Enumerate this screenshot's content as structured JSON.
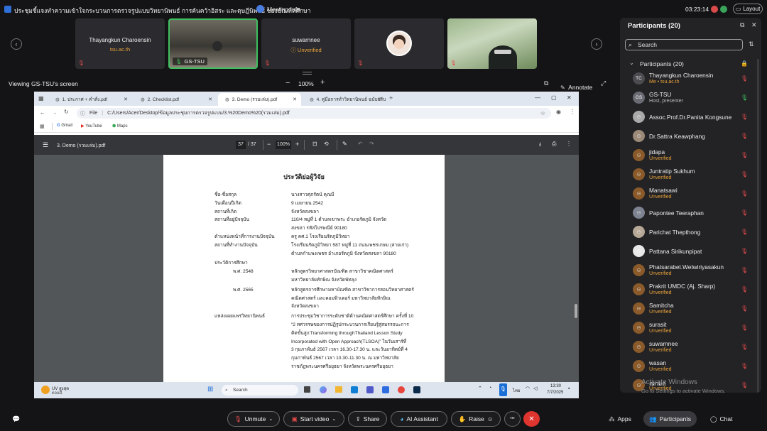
{
  "topbar": {
    "title": "ประชุมชี้แจงทำความเข้าใจกระบวนการตรวจรูปแบบวิทยานิพนธ์ การค้นคว้าอิสระ และดุษฎีนิพนธ์ ของบัณฑิตศึกษา",
    "meeting_info": "Meeting Info",
    "clock": "03:23:14",
    "layout": "Layout"
  },
  "filmstrip": [
    {
      "name": "Thayangkun Charoensin",
      "sub": "tsu.ac.th",
      "sub_color": "#e9a23b"
    },
    {
      "name": "GS-TSU",
      "sub": "",
      "sub_color": "#ffffff"
    },
    {
      "name": "suwarnnee",
      "sub": "Unverified",
      "sub_color": "#e9a23b"
    },
    {
      "name": "",
      "sub": "",
      "sub_color": "#ffffff"
    },
    {
      "name": "",
      "sub": "",
      "sub_color": "#ffffff"
    }
  ],
  "viewing": {
    "label": "Viewing GS-TSU's screen",
    "zoom": "100%",
    "annotate": "Annotate"
  },
  "browser": {
    "tabs": [
      "1. ประกาศ + คำสั่ง.pdf",
      "2. Checklist.pdf",
      "3. Demo (รวมเล่ม).pdf",
      "4. คู่มือการทำวิทยานิพนธ์ ฉบับปรับ"
    ],
    "url_prefix": "File",
    "url": "C:/Users/Acer/Desktop/ข้อมูลประชุมการตรวจรูปแบบ/3.%20Demo%20(รวมเล่ม).pdf",
    "bookmarks": [
      "Gmail",
      "YouTube",
      "Maps"
    ],
    "pdf_title": "3. Demo (รวมเล่ม).pdf",
    "page_current": "37",
    "page_total": "/ 37",
    "pdf_zoom": "100%"
  },
  "document": {
    "heading": "ประวัติย่อผู้วิจัย",
    "rows": [
      {
        "label": "ชื่อ-ชื่อสกุล",
        "value": "นางสาวศุภรัตน์ คุณมี"
      },
      {
        "label": "วันเดือนปีเกิด",
        "value": "9 เมษายน 2542"
      },
      {
        "label": "สถานที่เกิด",
        "value": "จังหวัดสงขลา"
      },
      {
        "label": "สถานที่อยู่ปัจจุบัน",
        "value": "110/4 หมู่ที่ 1 ตำบลเขาพระ อำเภอรัตภูมิ จังหวัด"
      },
      {
        "label": "",
        "value": "สงขลา รหัสไปรษณีย์ 90180"
      },
      {
        "label": "ตำแหน่งหน้าที่การงานปัจจุบัน",
        "value": "ครู คศ.1 โรงเรียนรัตภูมิวิทยา"
      },
      {
        "label": "สถานที่ทำงานปัจจุบัน",
        "value": "โรงเรียนรัตภูมิวิทยา 587 หมู่ที่ 11 ถนนเพชรเกษม (สายเก่า)"
      },
      {
        "label": "",
        "value": "ตำบลกำแพงเพชร อำเภอรัตภูมิ จังหวัดสงขลา 90180"
      }
    ],
    "edu_label": "ประวัติการศึกษา",
    "edu": [
      {
        "year": "พ.ศ. 2548",
        "lines": [
          "หลักสูตรวิทยาศาสตรบัณฑิต สาขาวิชาคณิตศาสตร์",
          "มหาวิทยาลัยทักษิณ จังหวัดพัทลุง"
        ]
      },
      {
        "year": "พ.ศ. 2565",
        "lines": [
          "หลักสูตรการศึกษามหาบัณฑิต สาขาวิชาการสอนวิทยาศาสตร์",
          "คณิตศาสตร์ และคอมพิวเตอร์ มหาวิทยาลัยทักษิณ",
          "จังหวัดสงขลา"
        ]
      }
    ],
    "pub_label": "แหล่งเผยแพร่วิทยานิพนธ์",
    "pub_lines": [
      "การประชุมวิชาการระดับชาติด้านคณิตศาสตร์ศึกษา ครั้งที่ 10",
      "“2 ทศวรรษของการปฏิรูปกระบวนการเรียนรู้สู่สมรรถนะการ",
      "คิดขั้นสูง:Transforming throughThailand Lesson Study",
      "Incorporated with Open Approach(TLSOA)” ในวันเสาร์ที่",
      "3 กุมภาพันธ์ 2567 เวลา 16.30-17.30 น. และวันอาทิตย์ที่ 4",
      "กุมภาพันธ์ 2567 เวลา 10.30-11.30 น. ณ มหาวิทยาลัย",
      "ราชภัฏพระนครศรีอยุธยา จังหวัดพระนครศรีอยุธยา"
    ]
  },
  "taskbar": {
    "weather": "UV สูงสุด",
    "weather_sub": "ตอนนี้",
    "search": "Search",
    "lang": "ไทย",
    "time": "13:30",
    "date": "7/7/2025"
  },
  "panel": {
    "title": "Participants (20)",
    "search_placeholder": "Search",
    "group_label": "Participants (20)",
    "participants": [
      {
        "name": "Thayangkun Charoensin",
        "sub": "Me • tsu.ac.th",
        "sub_color": "#e9a23b",
        "avatar": "TC",
        "avatar_color": "#4b4b50",
        "mic": "muted"
      },
      {
        "name": "GS-TSU",
        "sub": "Host, presenter",
        "sub_color": "#bbbbbb",
        "avatar": "GS",
        "avatar_color": "#6b6b73",
        "mic": "on"
      },
      {
        "name": "Assoc.Prof.Dr.Panita Kongsune",
        "sub": "",
        "sub_color": "#bbbbbb",
        "avatar": "",
        "avatar_color": "#a9a9a9",
        "mic": "muted"
      },
      {
        "name": "Dr.Sattra Keawphang",
        "sub": "",
        "sub_color": "#bbbbbb",
        "avatar": "",
        "avatar_color": "#9c8a78",
        "mic": "muted"
      },
      {
        "name": "jidapa",
        "sub": "Unverified",
        "sub_color": "#e9a23b",
        "avatar": "",
        "avatar_color": "#8a5a2a",
        "mic": "muted"
      },
      {
        "name": "Juntratip Sukhum",
        "sub": "Unverified",
        "sub_color": "#e9a23b",
        "avatar": "",
        "avatar_color": "#8a5a2a",
        "mic": "muted"
      },
      {
        "name": "Manatsawi",
        "sub": "Unverified",
        "sub_color": "#e9a23b",
        "avatar": "",
        "avatar_color": "#8a5a2a",
        "mic": "muted"
      },
      {
        "name": "Papontee Teeraphan",
        "sub": "",
        "sub_color": "#bbbbbb",
        "avatar": "",
        "avatar_color": "#7d8390",
        "mic": "muted"
      },
      {
        "name": "Parichat Thepthong",
        "sub": "",
        "sub_color": "#bbbbbb",
        "avatar": "",
        "avatar_color": "#b7a897",
        "mic": "muted"
      },
      {
        "name": "Pattana Sirikunpipat",
        "sub": "",
        "sub_color": "#bbbbbb",
        "avatar": "",
        "avatar_color": "#e8e8e8",
        "mic": "muted"
      },
      {
        "name": "Phatsarabet.Wetwiriyasakun",
        "sub": "Unverified",
        "sub_color": "#e9a23b",
        "avatar": "",
        "avatar_color": "#8a5a2a",
        "mic": "muted"
      },
      {
        "name": "Prakrit UMDC (Aj. Sharp)",
        "sub": "Unverified",
        "sub_color": "#e9a23b",
        "avatar": "",
        "avatar_color": "#8a5a2a",
        "mic": "muted"
      },
      {
        "name": "Samitcha",
        "sub": "Unverified",
        "sub_color": "#e9a23b",
        "avatar": "",
        "avatar_color": "#8a5a2a",
        "mic": "muted"
      },
      {
        "name": "surasit",
        "sub": "Unverified",
        "sub_color": "#e9a23b",
        "avatar": "",
        "avatar_color": "#8a5a2a",
        "mic": "muted"
      },
      {
        "name": "suwarnnee",
        "sub": "Unverified",
        "sub_color": "#e9a23b",
        "avatar": "",
        "avatar_color": "#8a5a2a",
        "mic": "muted"
      },
      {
        "name": "wasan",
        "sub": "Unverified",
        "sub_color": "#e9a23b",
        "avatar": "",
        "avatar_color": "#8a5a2a",
        "mic": "muted"
      },
      {
        "name": "ณกมล",
        "sub": "Unverified",
        "sub_color": "#e9a23b",
        "avatar": "",
        "avatar_color": "#8a5a2a",
        "mic": "muted"
      }
    ]
  },
  "watermark": {
    "title": "Activate Windows",
    "sub": "Go to Settings to activate Windows."
  },
  "controls": {
    "unmute": "Unmute",
    "start_video": "Start video",
    "share": "Share",
    "ai_assistant": "AI Assistant",
    "raise": "Raise",
    "more": "•••",
    "apps": "Apps",
    "participants": "Participants",
    "chat": "Chat"
  },
  "colors": {
    "accent_red": "#e54b4b",
    "unverified": "#e9a23b",
    "leave": "#e0342f",
    "active_speaker": "#3fbf5f"
  }
}
